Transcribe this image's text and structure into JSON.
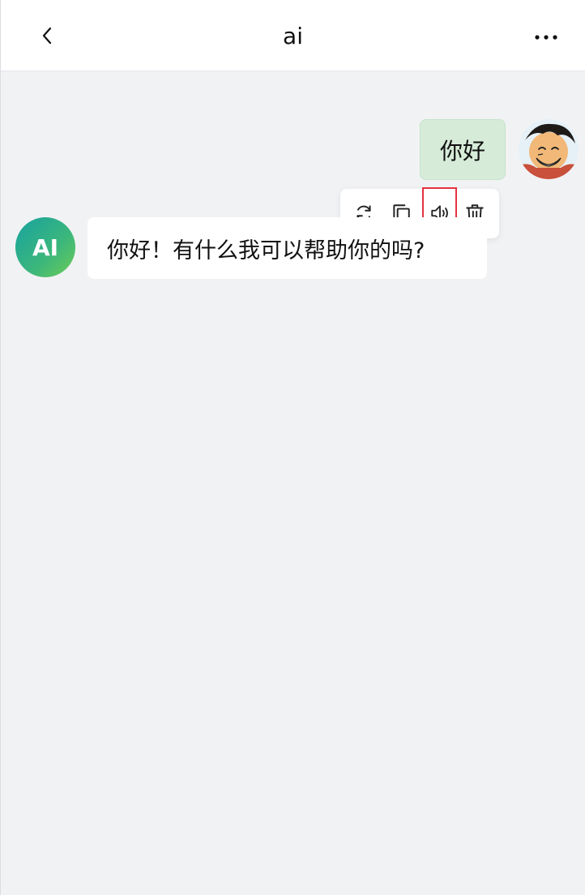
{
  "header": {
    "back_icon": "chevron-left-icon",
    "title": "ai",
    "more_icon": "more-horizontal-icon"
  },
  "messages": [
    {
      "role": "user",
      "text": "你好",
      "avatar": "cartoon-avatar"
    },
    {
      "role": "ai",
      "text": "你好！有什么我可以帮助你的吗?",
      "avatar_label": "AI"
    }
  ],
  "message_toolbar": {
    "items": [
      {
        "icon": "refresh-icon"
      },
      {
        "icon": "copy-icon"
      },
      {
        "icon": "speaker-icon",
        "highlighted": true
      },
      {
        "icon": "trash-icon"
      }
    ]
  },
  "colors": {
    "background": "#f1f2f4",
    "user_bubble": "#d6ecd9",
    "ai_bubble": "#ffffff",
    "highlight_border": "#e53240",
    "ai_avatar_gradient_start": "#17a2a0",
    "ai_avatar_gradient_end": "#6dcc55"
  }
}
